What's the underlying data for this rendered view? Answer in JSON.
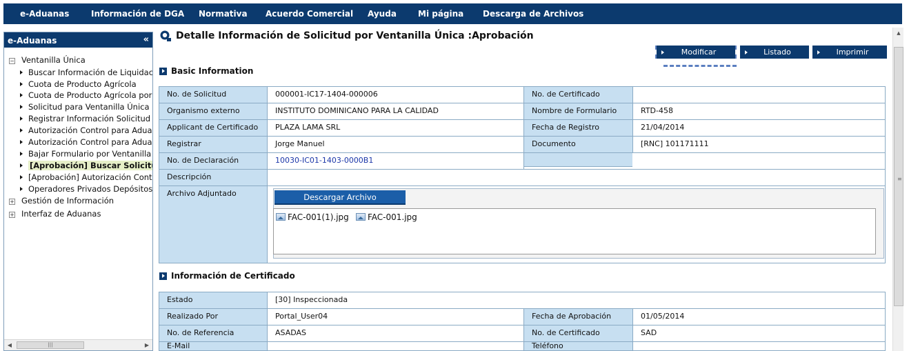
{
  "topnav": {
    "items": [
      "e-Aduanas",
      "Información de DGA",
      "Normativa",
      "Acuerdo Comercial",
      "Ayuda",
      "Mi página",
      "Descarga de Archivos"
    ]
  },
  "sidebar": {
    "title": "e-Aduanas",
    "collapse": "«",
    "tree": [
      {
        "label": "Ventanilla Única",
        "type": "group",
        "expander": "⊟"
      },
      {
        "label": "Buscar Información de Liquidación",
        "type": "item"
      },
      {
        "label": "Cuota de Producto Agrícola",
        "type": "item"
      },
      {
        "label": "Cuota de Producto Agrícola por",
        "type": "item"
      },
      {
        "label": "Solicitud para Ventanilla Única",
        "type": "item"
      },
      {
        "label": "Registrar Información Solicitud",
        "type": "item"
      },
      {
        "label": "Autorización Control para Aduanas",
        "type": "item"
      },
      {
        "label": "Autorización Control para Aduanas",
        "type": "item"
      },
      {
        "label": "Bajar Formulario por Ventanilla",
        "type": "item"
      },
      {
        "label": "[Aprobación] Buscar Solicitud",
        "type": "item",
        "selected": true
      },
      {
        "label": "[Aprobación] Autorización Control",
        "type": "item"
      },
      {
        "label": "Operadores Privados Depósitos",
        "type": "item"
      },
      {
        "label": "Gestión de Información",
        "type": "group",
        "expander": "⊞"
      },
      {
        "label": "Interfaz de Aduanas",
        "type": "group",
        "expander": "⊞"
      }
    ]
  },
  "page": {
    "title": "Detalle Información de Solicitud por Ventanilla Única :Aprobación"
  },
  "actions": {
    "modify": "Modificar",
    "list": "Listado",
    "print": "Imprimir"
  },
  "basic": {
    "section_title": "Basic Information",
    "no_solicitud_label": "No. de Solicitud",
    "no_solicitud": "000001-IC17-1404-000006",
    "no_certificado_label": "No. de Certificado",
    "no_certificado": "",
    "organismo_label": "Organismo externo",
    "organismo": "INSTITUTO DOMINICANO PARA LA CALIDAD",
    "nombre_form_label": "Nombre de Formulario",
    "nombre_form": "RTD-458",
    "applicant_label": "Applicant de Certificado",
    "applicant": "PLAZA LAMA SRL",
    "fecha_registro_label": "Fecha de Registro",
    "fecha_registro": "21/04/2014",
    "registrar_label": "Registrar",
    "registrar": "Jorge Manuel",
    "documento_label": "Documento",
    "documento": "[RNC] 101171111",
    "declaracion_label": "No. de Declaración",
    "declaracion": "10030-IC01-1403-0000B1",
    "descripcion_label": "Descripción",
    "descripcion": "",
    "archivo_label": "Archivo Adjuntado",
    "download_button": "Descargar Archivo",
    "files": [
      "FAC-001(1).jpg",
      "FAC-001.jpg"
    ]
  },
  "cert": {
    "section_title": "Información de Certificado",
    "estado_label": "Estado",
    "estado": "[30] Inspeccionada",
    "realizado_label": "Realizado Por",
    "realizado": "Portal_User04",
    "fecha_aprob_label": "Fecha de Aprobación",
    "fecha_aprob": "01/05/2014",
    "referencia_label": "No. de Referencia",
    "referencia": "ASADAS",
    "no_cert_label": "No. de Certificado",
    "no_cert": "SAD",
    "email_label": "E-Mail",
    "email": "",
    "telefono_label": "Teléfono",
    "telefono": ""
  },
  "colors": {
    "nav_bg": "#0c3a6e",
    "label_cell": "#c7dff1",
    "link": "#1a35a8",
    "selected_item": "#e6efc8"
  }
}
